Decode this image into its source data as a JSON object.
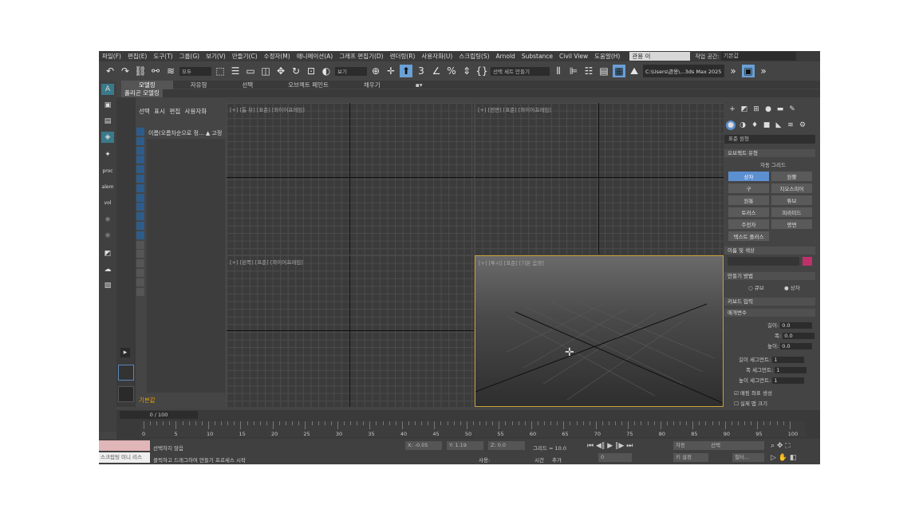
{
  "menu": [
    "파일(F)",
    "편집(E)",
    "도구(T)",
    "그룹(G)",
    "보기(V)",
    "만들기(C)",
    "수정자(M)",
    "애니메이션(A)",
    "그래프 편집기(D)",
    "렌더링(R)",
    "사용자화(U)",
    "스크립팅(S)",
    "Arnold",
    "Substance",
    "Civil View",
    "도움말(H)"
  ],
  "workspace": {
    "user": "관용 이",
    "label": "작업 공간:",
    "value": "기본값"
  },
  "toolbar": {
    "filter": "모두",
    "selset": "선택 세트 만들기",
    "view": "보기",
    "path": "C:\\Users\\관용\\...3ds Max 2025"
  },
  "ribbon": {
    "tabs": [
      "모델링",
      "자유형",
      "선택",
      "오브젝트 페인트",
      "채우기"
    ],
    "sub": "폴리곤 모델링"
  },
  "scene": {
    "menu": "선택  표시  편집  사용자화",
    "row": "이름(오름차순으로 정... ▲ 고정",
    "bottom": "기본값"
  },
  "viewports": {
    "top": "[+] [톱 뷰] [표준] [와이어프레임]",
    "front": "[+] [전면] [표준] [와이어프레임]",
    "left": "[+] [왼쪽] [표준] [와이어프레임]",
    "persp": "[+] [투시] [표준] [기본 음영]"
  },
  "command": {
    "category": "표준 원형",
    "rollout_types": "오브젝트 유형",
    "autogrid": "자동 그리드",
    "buttons": [
      "상자",
      "원뿔",
      "구",
      "지오스피어",
      "원통",
      "튜브",
      "토러스",
      "피라미드",
      "주전자",
      "평면",
      "텍스트 플러스"
    ],
    "rollout_name": "이름 및 색상",
    "rollout_method": "만들기 방법",
    "method_options": [
      "큐브",
      "상자"
    ],
    "rollout_kbd": "키보드 입력",
    "rollout_params": "매개변수",
    "params": [
      {
        "label": "길이:",
        "value": "0.0"
      },
      {
        "label": "폭:",
        "value": "0.0"
      },
      {
        "label": "높이:",
        "value": "0.0"
      },
      {
        "label": "길이 세그먼트:",
        "value": "1"
      },
      {
        "label": "폭 세그먼트:",
        "value": "1"
      },
      {
        "label": "높이 세그먼트:",
        "value": "1"
      }
    ],
    "gen_mapping": "매핑 좌표 생성",
    "real_world": "실제 맵 크기",
    "color": "#c0306a"
  },
  "timeline": {
    "frame": "0 / 100",
    "ticks": [
      "0",
      "5",
      "10",
      "15",
      "20",
      "25",
      "30",
      "35",
      "40",
      "45",
      "50",
      "55",
      "60",
      "65",
      "70",
      "75",
      "80",
      "85",
      "90",
      "95",
      "100"
    ]
  },
  "status": {
    "macro": "스크립팅 미니 리스",
    "selection": "선택하지 않음",
    "hint": "클릭하고 드래그하여 만들기 프로세스 시작",
    "x": "X: -0.05",
    "y": "Y: 1.19",
    "z": "Z: 0.0",
    "grid": "그리드 = 10.0",
    "time": "시간",
    "add": "추가",
    "auto": "자동",
    "set_key": "키 설정",
    "selected": "선택",
    "filter": "필터...",
    "frame": "0",
    "set_label": "사용:"
  }
}
